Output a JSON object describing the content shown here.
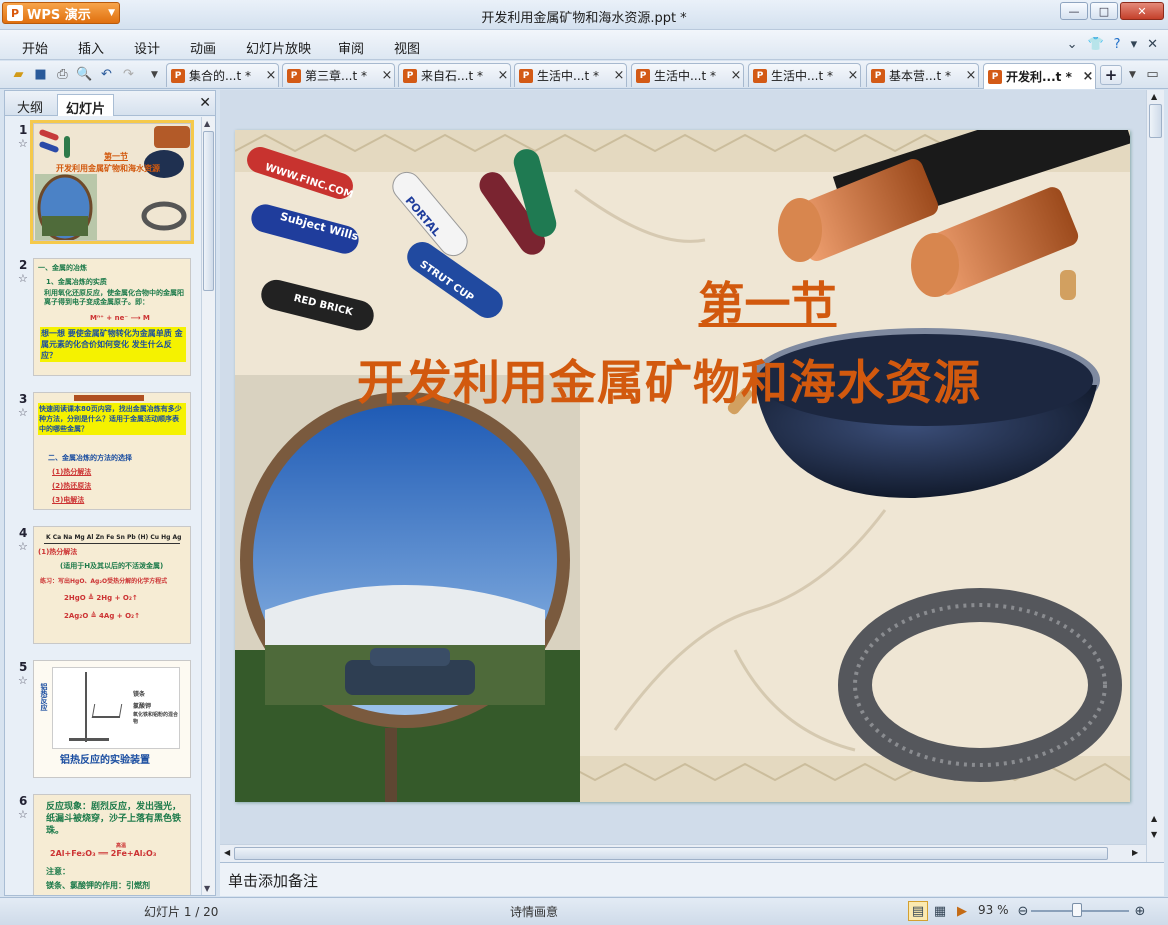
{
  "app": {
    "name": "WPS 演示",
    "window_title": "开发利用金属矿物和海水资源.ppt *"
  },
  "menu": [
    "开始",
    "插入",
    "设计",
    "动画",
    "幻灯片放映",
    "审阅",
    "视图"
  ],
  "tabs": [
    {
      "label": "集合的...t *",
      "active": false
    },
    {
      "label": "第三章...t *",
      "active": false
    },
    {
      "label": "来自石...t *",
      "active": false
    },
    {
      "label": "生活中...t *",
      "active": false
    },
    {
      "label": "生活中...t *",
      "active": false
    },
    {
      "label": "生活中...t *",
      "active": false
    },
    {
      "label": "基本营...t *",
      "active": false
    },
    {
      "label": "开发利...t *",
      "active": true
    }
  ],
  "panel": {
    "tab_outline": "大纲",
    "tab_slides": "幻灯片"
  },
  "thumbnails": [
    {
      "num": "1",
      "lines": [
        "第一节",
        "开发利用金属矿物和海水资源"
      ]
    },
    {
      "num": "2",
      "lines": [
        "一、金属的冶炼",
        "1、金属冶炼的实质",
        "利用氧化还原反应，使金属化合物中的金属阳离子得到电子变成金属原子。即：",
        "Mⁿ⁺ + ne⁻ ⟶ M",
        "想一想 要使金属矿物转化为金属单质 金属元素的化合价如何变化 发生什么反应？"
      ]
    },
    {
      "num": "3",
      "lines": [
        "快速阅读课本80页内容，找出金属冶炼有多少种方法，分别是什么？适用于金属活动顺序表中的哪些金属？",
        "二、金属冶炼的方法的选择",
        "(1)热分解法",
        "(2)热还原法",
        "(3)电解法"
      ]
    },
    {
      "num": "4",
      "lines": [
        "K Ca Na Mg Al Zn Fe Sn Pb (H) Cu Hg Ag",
        "(1)热分解法",
        "(适用于H及其以后的不活泼金属)",
        "练习：写出HgO、Ag₂O受热分解的化学方程式",
        "2HgO ≜ 2Hg + O₂↑",
        "2Ag₂O ≜ 4Ag + O₂↑"
      ]
    },
    {
      "num": "5",
      "lines": [
        "铝热反应",
        "铝热反应的实验装置",
        "镁条",
        "氯酸钾",
        "氧化铁和铝粉的混合物"
      ]
    },
    {
      "num": "6",
      "lines": [
        "反应现象：剧烈反应，发出强光，纸漏斗被烧穿，沙子上落有黑色铁珠。",
        "2Al+Fe₂O₃ ══ 2Fe+Al₂O₃",
        "高温",
        "注意：",
        "镁条、氯酸钾的作用：引燃剂"
      ]
    }
  ],
  "slide": {
    "title_line1": "第一节",
    "title_line2": "开发利用金属矿物和海水资源",
    "knife_texts": [
      "WWW.FINC.COM",
      "Subject Wills",
      "PORTAL",
      "RED BRICK",
      "STRUT CUP"
    ]
  },
  "notes_placeholder": "单击添加备注",
  "status": {
    "slide_counter": "幻灯片 1 / 20",
    "theme": "诗情画意",
    "zoom": "93 %"
  },
  "colors": {
    "accent_orange": "#d2590e",
    "selection": "#f5c94b"
  }
}
